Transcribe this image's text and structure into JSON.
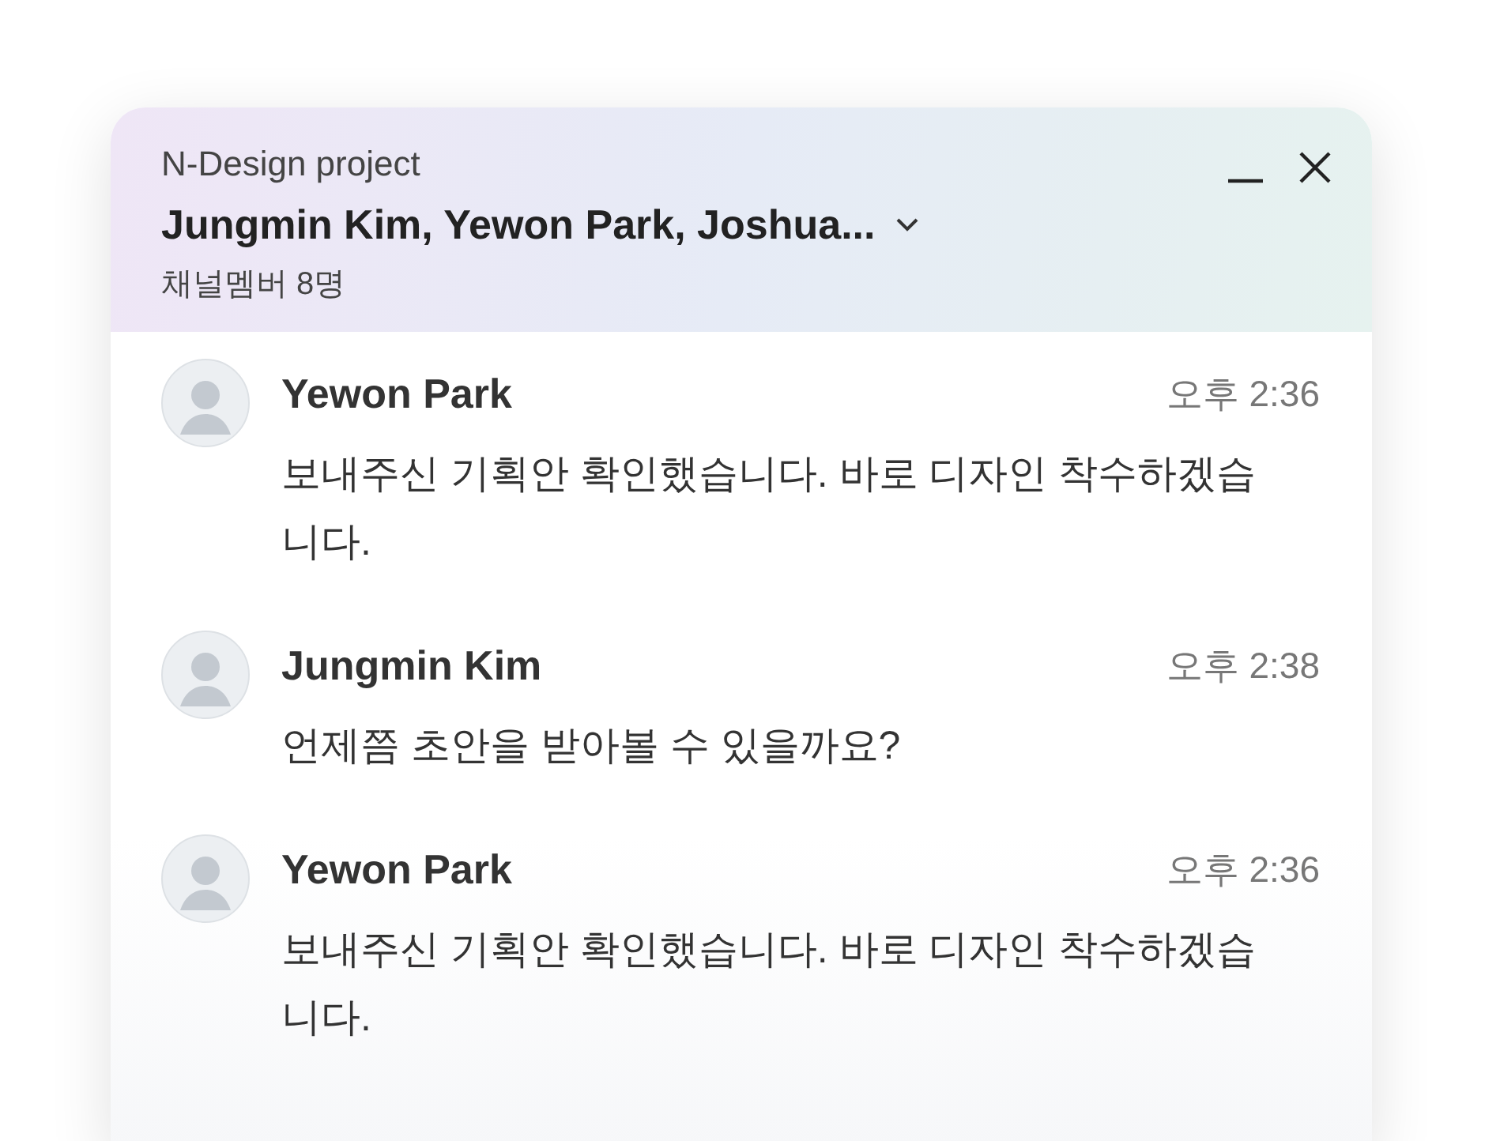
{
  "header": {
    "project": "N-Design project",
    "members_title": "Jungmin Kim, Yewon Park, Joshua...",
    "member_count": "채널멤버 8명"
  },
  "messages": [
    {
      "sender": "Yewon Park",
      "time": "오후 2:36",
      "text": "보내주신 기획안 확인했습니다. 바로 디자인 착수하겠습니다."
    },
    {
      "sender": "Jungmin Kim",
      "time": "오후 2:38",
      "text": "언제쯤 초안을 받아볼 수 있을까요?"
    },
    {
      "sender": "Yewon Park",
      "time": "오후 2:36",
      "text": "보내주신 기획안 확인했습니다. 바로 디자인 착수하겠습니다."
    }
  ]
}
